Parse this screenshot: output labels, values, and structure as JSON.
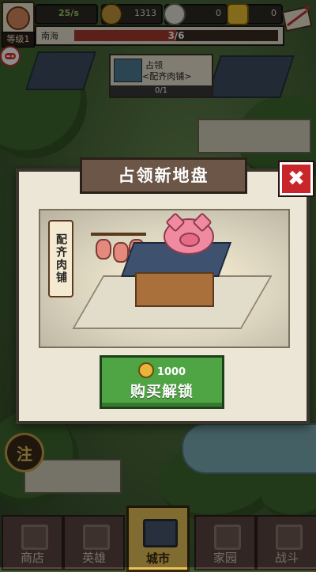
{
  "hud": {
    "level_label": "等级1",
    "rate": "25/s",
    "coins": "1313",
    "resource_2": "0",
    "gold": "0",
    "region_name": "南海",
    "region_progress": "3/6",
    "region_progress_fraction": 0.5
  },
  "building_tag": {
    "title": "占领",
    "name": "<配齐肉铺>",
    "count": "0/1"
  },
  "modal": {
    "title": "占领新地盘",
    "close_label": "✖",
    "shop_label": "配齐肉铺",
    "price": "1000",
    "buy_label": "购买解锁"
  },
  "side": {
    "note_label": "注"
  },
  "nav": {
    "tabs": [
      {
        "label": "商店",
        "active": false
      },
      {
        "label": "英雄",
        "active": false
      },
      {
        "label": "城市",
        "active": true
      },
      {
        "label": "家园",
        "active": false
      },
      {
        "label": "战斗",
        "active": false
      }
    ]
  }
}
